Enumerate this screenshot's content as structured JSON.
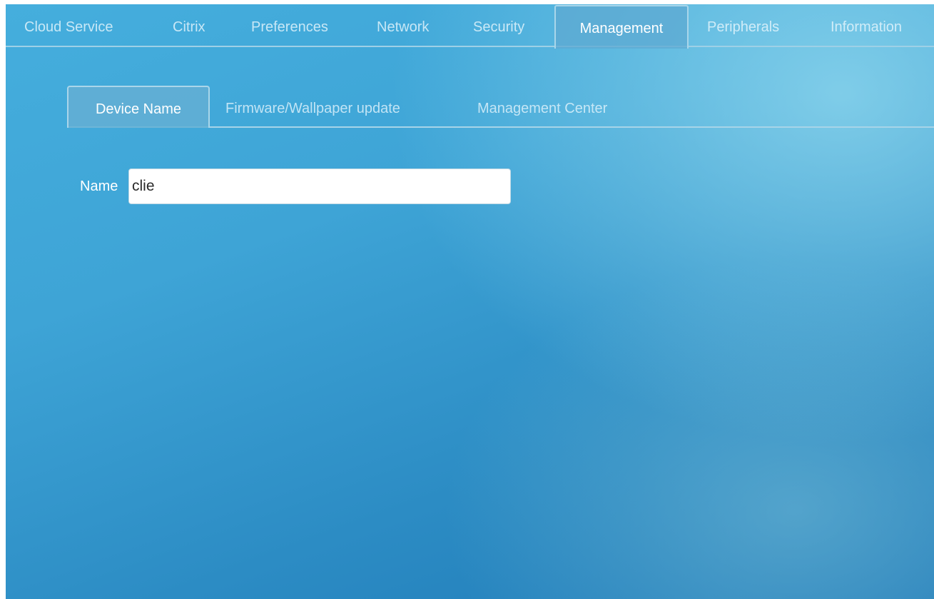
{
  "top_tabs": [
    {
      "label": "Cloud Service",
      "active": false
    },
    {
      "label": "Citrix",
      "active": false
    },
    {
      "label": "Preferences",
      "active": false
    },
    {
      "label": "Network",
      "active": false
    },
    {
      "label": "Security",
      "active": false
    },
    {
      "label": "Management",
      "active": true
    },
    {
      "label": "Peripherals",
      "active": false
    },
    {
      "label": "Information",
      "active": false
    }
  ],
  "sub_tabs": [
    {
      "label": "Device Name",
      "active": true
    },
    {
      "label": "Firmware/Wallpaper update",
      "active": false
    },
    {
      "label": "Management Center",
      "active": false
    }
  ],
  "form": {
    "name_label": "Name",
    "name_value": "clie"
  },
  "colors": {
    "background_top": "#45aedd",
    "background_bottom": "#1f7ab8",
    "active_tab": "#5eaad2",
    "tab_border": "#a9d6ea"
  }
}
